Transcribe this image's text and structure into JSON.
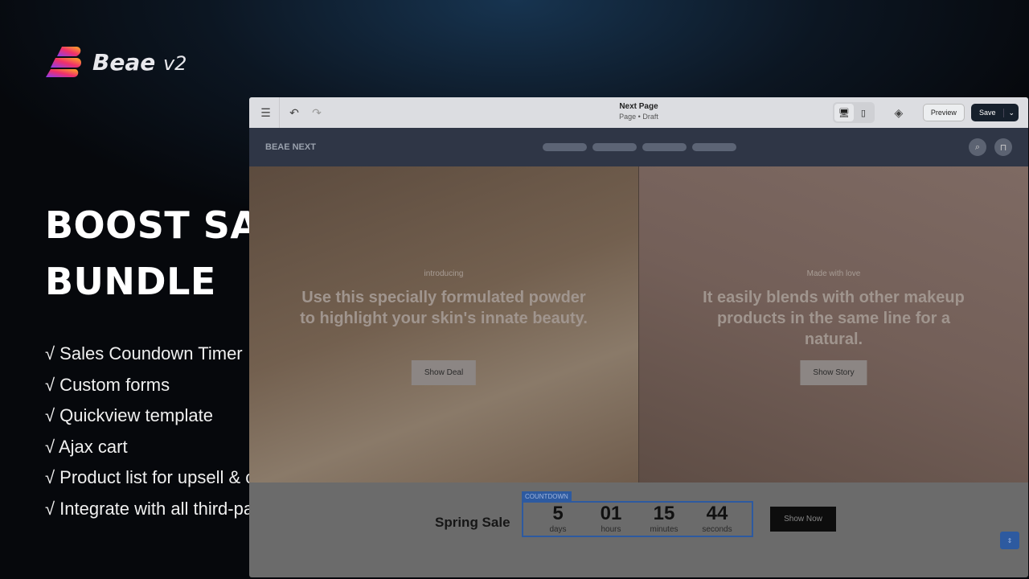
{
  "brand": {
    "name": "Beae",
    "version": "v2"
  },
  "headline": [
    "BOOST SALES",
    "BUNDLE"
  ],
  "features": [
    "√ Sales Coundown Timer",
    "√ Custom forms",
    "√ Quickview template",
    "√ Ajax cart",
    "√ Product list for upsell & cross sell",
    "√ Integrate with all third-party upsell apps"
  ],
  "editor": {
    "title": "Next Page",
    "subtitle": "Page • Draft",
    "preview": "Preview",
    "save": "Save",
    "store_brand": "BEAE NEXT",
    "heroes": [
      {
        "eyebrow": "introducing",
        "heading": "Use this specially formulated powder to highlight your skin's innate beauty.",
        "button": "Show Deal"
      },
      {
        "eyebrow": "Made with love",
        "heading": "It easily blends with other makeup products in the same line for a natural.",
        "button": "Show Story"
      }
    ],
    "countdown": {
      "title": "Spring Sale",
      "tag": "COUNTDOWN",
      "units": [
        {
          "n": "5",
          "l": "days"
        },
        {
          "n": "01",
          "l": "hours"
        },
        {
          "n": "15",
          "l": "minutes"
        },
        {
          "n": "44",
          "l": "seconds"
        }
      ],
      "button": "Show Now"
    }
  },
  "colors": {
    "accent": "#2d5aa0",
    "save_bg": "#16202c"
  }
}
